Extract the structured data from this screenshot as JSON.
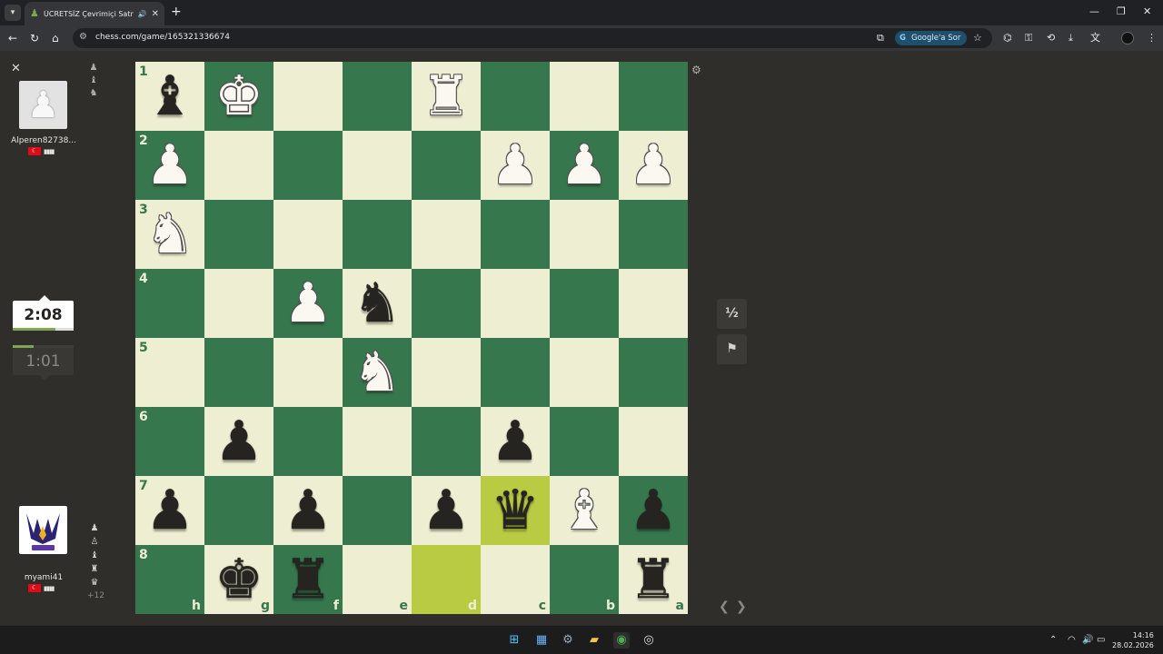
{
  "browser": {
    "tab_title": "ÜCRETSİZ Çevrimiçi Satranç",
    "url": "chess.com/game/165321336674",
    "ask_google": "Google'a Sor"
  },
  "players": {
    "top": {
      "name": "Alperen82738...",
      "country": "Turkey"
    },
    "bottom": {
      "name": "myami41",
      "country": "Turkey",
      "material_advantage": "+12"
    }
  },
  "clocks": {
    "active": "2:08",
    "idle": "1:01"
  },
  "buttons": {
    "draw": "½"
  },
  "board": {
    "orientation": "black",
    "ranks": [
      "1",
      "2",
      "3",
      "4",
      "5",
      "6",
      "7",
      "8"
    ],
    "files": [
      "h",
      "g",
      "f",
      "e",
      "d",
      "c",
      "b",
      "a"
    ],
    "highlighted": [
      "d8",
      "c7"
    ],
    "rows": [
      [
        "b:b",
        "w:k",
        "",
        "",
        "w:r",
        "",
        "",
        ""
      ],
      [
        "w:p",
        "",
        "",
        "",
        "",
        "w:p",
        "w:p",
        "w:p"
      ],
      [
        "w:n",
        "",
        "",
        "",
        "",
        "",
        "",
        ""
      ],
      [
        "",
        "",
        "w:p",
        "b:n",
        "",
        "",
        "",
        ""
      ],
      [
        "",
        "",
        "",
        "w:n",
        "",
        "",
        "",
        ""
      ],
      [
        "",
        "b:p",
        "",
        "",
        "",
        "b:p",
        "",
        ""
      ],
      [
        "b:p",
        "",
        "b:p",
        "",
        "b:p",
        "b:q",
        "w:b",
        "b:p"
      ],
      [
        "",
        "b:k",
        "b:r",
        "",
        "",
        "",
        "",
        "b:r"
      ]
    ]
  },
  "taskbar": {
    "time": "14:16",
    "date": "28.02.2026"
  }
}
